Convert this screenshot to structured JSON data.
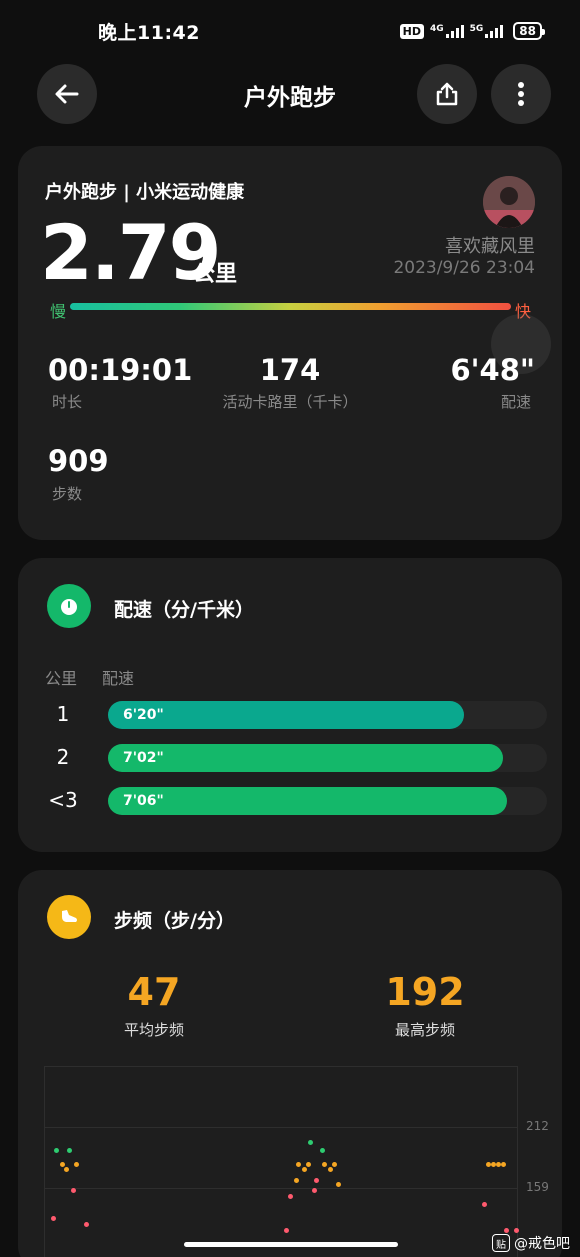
{
  "status": {
    "time": "晚上11:42",
    "hd": "HD",
    "net1": "4G",
    "net2": "5G",
    "battery": "88"
  },
  "header": {
    "title": "户外跑步",
    "back_icon": "arrow-left-icon",
    "share_icon": "share-icon",
    "more_icon": "more-vertical-icon"
  },
  "summary": {
    "source": "户外跑步 | 小米运动健康",
    "distance": "2.79",
    "distance_unit": "公里",
    "user_name": "喜欢藏风里",
    "datetime": "2023/9/26 23:04",
    "slow_label": "慢",
    "fast_label": "快",
    "duration": {
      "value": "00:19:01",
      "label": "时长"
    },
    "calories": {
      "value": "174",
      "label": "活动卡路里（千卡）"
    },
    "pace": {
      "value": "6'48\"",
      "label": "配速"
    },
    "steps": {
      "value": "909",
      "label": "步数"
    }
  },
  "pace_section": {
    "title": "配速（分/千米）",
    "col_km": "公里",
    "col_pace": "配速",
    "rows": [
      {
        "km": "1",
        "pace": "6'20\"",
        "fraction": 0.81,
        "color": "#0aa88e"
      },
      {
        "km": "2",
        "pace": "7'02\"",
        "fraction": 0.9,
        "color": "#14b86a"
      },
      {
        "km": "<3",
        "pace": "7'06\"",
        "fraction": 0.91,
        "color": "#14b86a"
      }
    ]
  },
  "cadence_section": {
    "title": "步频（步/分）",
    "avg": {
      "value": "47",
      "label": "平均步频"
    },
    "max": {
      "value": "192",
      "label": "最高步频"
    },
    "y_ticks": [
      "212",
      "159"
    ]
  },
  "watermark": {
    "icon": "贴",
    "text": "@戒色吧"
  },
  "colors": {
    "accent_orange": "#f5a623",
    "green": "#14b86a",
    "teal": "#0aa88e"
  }
}
